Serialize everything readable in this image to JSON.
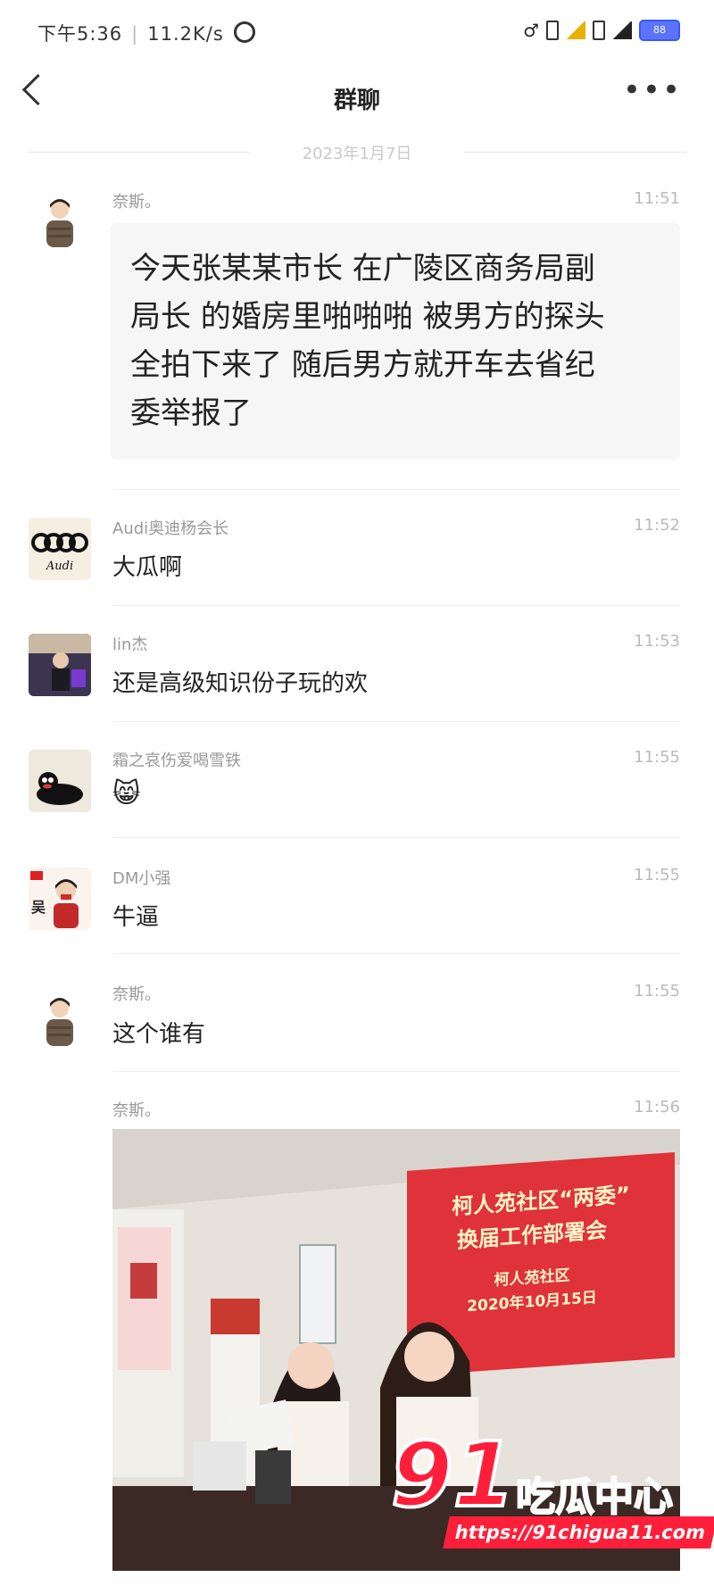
{
  "status_bar": {
    "time": "下午5:36",
    "network_speed": "11.2K/s",
    "battery": "88",
    "network_type": "4G"
  },
  "nav": {
    "title": "群聊"
  },
  "date_separator": "2023年1月7日",
  "messages": [
    {
      "sender": "奈斯。",
      "time": "11:51",
      "text_lines": [
        "今天张某某市长 在广陵区商务局副",
        "局长 的婚房里啪啪啪 被男方的探头",
        "全拍下来了 随后男方就开车去省纪",
        "委举报了"
      ]
    },
    {
      "sender": "Audi奥迪杨会长",
      "time": "11:52",
      "text": "大瓜啊",
      "avatar_text": "Audi"
    },
    {
      "sender": "lin杰",
      "time": "11:53",
      "text": "还是高级知识份子玩的欢"
    },
    {
      "sender": "霜之哀伤爱喝雪铁",
      "time": "11:55",
      "text": "😸"
    },
    {
      "sender": "DM小强",
      "time": "11:55",
      "text": "牛逼",
      "avatar_text": "吴"
    },
    {
      "sender": "奈斯。",
      "time": "11:55",
      "text": "这个谁有"
    },
    {
      "sender": "奈斯。",
      "time": "11:56"
    }
  ],
  "photo": {
    "banner_line1": "柯人苑社区“两委”",
    "banner_line2": "换届工作部署会",
    "banner_line3": "柯人苑社区",
    "banner_line4": "2020年10月15日"
  },
  "watermark": {
    "number": "91",
    "name": "吃瓜中心",
    "url": "https://91chigua11.com"
  },
  "colors": {
    "watermark_red": "#ff1f3a",
    "banner_red": "#e0323a",
    "quote_bg": "#f6f6f6"
  }
}
